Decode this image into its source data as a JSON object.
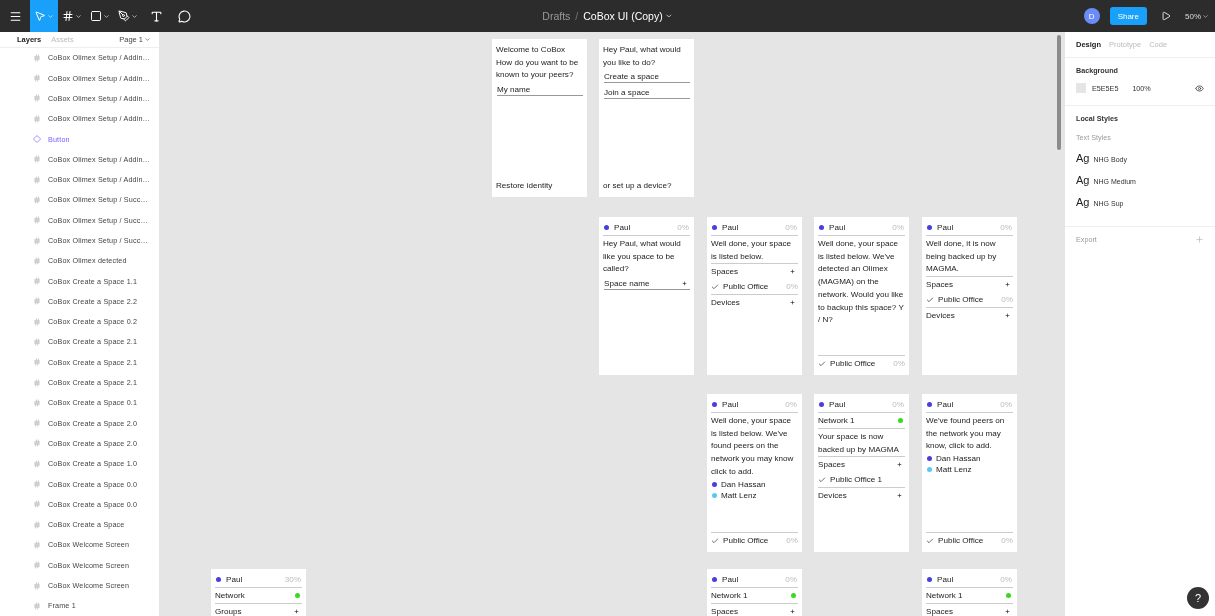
{
  "toolbar": {
    "tools": [
      {
        "kind": "move",
        "selected": true
      },
      {
        "kind": "frame",
        "selected": false
      },
      {
        "kind": "shape",
        "selected": false
      },
      {
        "kind": "pen",
        "selected": false
      },
      {
        "kind": "text",
        "selected": false
      },
      {
        "kind": "comment",
        "selected": false
      }
    ],
    "breadcrumb": "Drafts",
    "separator": "/",
    "file_name": "CoBox UI (Copy)",
    "avatar": "D",
    "share": "Share",
    "zoom": "50%"
  },
  "layers_panel": {
    "tabs": [
      {
        "label": "Layers",
        "selected": true
      },
      {
        "label": "Assets",
        "selected": false
      }
    ],
    "page": "Page 1",
    "layers": [
      {
        "kind": "frame",
        "name": "CoBox Olimex Setup / Addin…"
      },
      {
        "kind": "frame",
        "name": "CoBox Olimex Setup / Addin…"
      },
      {
        "kind": "frame",
        "name": "CoBox Olimex Setup / Addin…"
      },
      {
        "kind": "frame",
        "name": "CoBox Olimex Setup / Addin…"
      },
      {
        "kind": "component",
        "name": "Button"
      },
      {
        "kind": "frame",
        "name": "CoBox Olimex Setup / Addin…"
      },
      {
        "kind": "frame",
        "name": "CoBox Olimex Setup / Addin…"
      },
      {
        "kind": "frame",
        "name": "CoBox Olimex Setup / Succ…"
      },
      {
        "kind": "frame",
        "name": "CoBox Olimex Setup / Succ…"
      },
      {
        "kind": "frame",
        "name": "CoBox Olimex Setup / Succ…"
      },
      {
        "kind": "frame",
        "name": "CoBox Olimex detected"
      },
      {
        "kind": "frame",
        "name": "CoBox Create a Space 1.1"
      },
      {
        "kind": "frame",
        "name": "CoBox Create a Space 2.2"
      },
      {
        "kind": "frame",
        "name": "CoBox Create a Space 0.2"
      },
      {
        "kind": "frame",
        "name": "CoBox Create a Space 2.1"
      },
      {
        "kind": "frame",
        "name": "CoBox Create a Space 2.1"
      },
      {
        "kind": "frame",
        "name": "CoBox Create a Space 2.1"
      },
      {
        "kind": "frame",
        "name": "CoBox Create a Space 0.1"
      },
      {
        "kind": "frame",
        "name": "CoBox Create a Space 2.0"
      },
      {
        "kind": "frame",
        "name": "CoBox Create a Space 2.0"
      },
      {
        "kind": "frame",
        "name": "CoBox Create a Space 1.0"
      },
      {
        "kind": "frame",
        "name": "CoBox Create a Space 0.0"
      },
      {
        "kind": "frame",
        "name": "CoBox Create a Space 0.0"
      },
      {
        "kind": "frame",
        "name": "CoBox Create a Space"
      },
      {
        "kind": "frame",
        "name": "CoBox Welcome Screen"
      },
      {
        "kind": "frame",
        "name": "CoBox Welcome Screen"
      },
      {
        "kind": "frame",
        "name": "CoBox Welcome Screen"
      },
      {
        "kind": "frame",
        "name": "Frame 1"
      }
    ]
  },
  "canvas": {
    "frames": [
      {
        "blocks": [
          {
            "kind": "text",
            "text": "Welcome to CoBox"
          },
          {
            "kind": "text",
            "text": "How do you want to be known to your peers?"
          },
          {
            "kind": "field",
            "text": "My name"
          },
          {
            "kind": "bottom_text",
            "text": "Restore identity"
          }
        ]
      },
      {
        "blocks": [
          {
            "kind": "text",
            "text": "Hey Paul, what would you like to do?"
          },
          {
            "kind": "field",
            "text": "Create a space"
          },
          {
            "kind": "field",
            "text": "Join a space"
          },
          {
            "kind": "bottom_text",
            "text": "or set up a device?"
          }
        ]
      },
      {
        "blocks": [
          {
            "kind": "header",
            "name": "Paul",
            "color": "#4b3ee0",
            "percent": "0%"
          },
          {
            "kind": "text",
            "text": "Hey Paul, what would like you space to be called?"
          },
          {
            "kind": "field",
            "text": "Space name",
            "plus": true
          }
        ]
      },
      {
        "blocks": [
          {
            "kind": "header",
            "name": "Paul",
            "color": "#4b3ee0",
            "percent": "0%"
          },
          {
            "kind": "text",
            "text": "Well done, your space is listed below."
          },
          {
            "kind": "section",
            "text": "Spaces"
          },
          {
            "kind": "item",
            "text": "Public Office",
            "percent": "0%"
          },
          {
            "kind": "section",
            "text": "Devices"
          }
        ]
      },
      {
        "blocks": [
          {
            "kind": "header",
            "name": "Paul",
            "color": "#4b3ee0",
            "percent": "0%"
          },
          {
            "kind": "text",
            "text": "Well done, your space is listed below. We've detected an Olimex (MAGMA) on the network. Would you like to backup this space? Y / N?"
          },
          {
            "kind": "footer_item",
            "text": "Public Office",
            "percent": "0%"
          }
        ]
      },
      {
        "blocks": [
          {
            "kind": "header",
            "name": "Paul",
            "color": "#4b3ee0",
            "percent": "0%"
          },
          {
            "kind": "text",
            "text": "Well done, it is now being backed up by MAGMA."
          },
          {
            "kind": "section",
            "text": "Spaces"
          },
          {
            "kind": "item",
            "text": "Public Office",
            "percent": "0%"
          },
          {
            "kind": "section",
            "text": "Devices"
          }
        ]
      },
      {
        "blocks": [
          {
            "kind": "header",
            "name": "Paul",
            "color": "#4b3ee0",
            "percent": "0%"
          },
          {
            "kind": "text",
            "text": "Well done, your space is listed below. We've found peers on the network you may know click to add."
          },
          {
            "kind": "person",
            "text": "Dan Hassan",
            "color": "#4b3ee0"
          },
          {
            "kind": "person",
            "text": "Matt Lenz",
            "color": "#5ac8f0"
          },
          {
            "kind": "footer_item",
            "text": "Public Office",
            "percent": "0%"
          }
        ]
      },
      {
        "blocks": [
          {
            "kind": "header",
            "name": "Paul",
            "color": "#4b3ee0",
            "percent": "0%"
          },
          {
            "kind": "network",
            "text": "Network 1",
            "color": "#3ad81e"
          },
          {
            "kind": "text",
            "text": "Your space is now backed up by MAGMA"
          },
          {
            "kind": "section",
            "text": "Spaces"
          },
          {
            "kind": "item",
            "text": "Public Office 1"
          },
          {
            "kind": "section",
            "text": "Devices"
          }
        ]
      },
      {
        "blocks": [
          {
            "kind": "header",
            "name": "Paul",
            "color": "#4b3ee0",
            "percent": "0%"
          },
          {
            "kind": "text",
            "text": "We've found peers on the network you may know, click to add."
          },
          {
            "kind": "person",
            "text": "Dan Hassan",
            "color": "#4b3ee0"
          },
          {
            "kind": "person",
            "text": "Matt Lenz",
            "color": "#5ac8f0"
          },
          {
            "kind": "footer_item",
            "text": "Public Office",
            "percent": "0%"
          }
        ]
      },
      {
        "blocks": [
          {
            "kind": "header",
            "name": "Paul",
            "color": "#4b3ee0",
            "percent": "30%"
          },
          {
            "kind": "network",
            "text": "Network",
            "color": "#3ad81e"
          },
          {
            "kind": "section",
            "text": "Groups"
          }
        ]
      },
      {
        "blocks": [
          {
            "kind": "header",
            "name": "Paul",
            "color": "#4b3ee0",
            "percent": "0%"
          },
          {
            "kind": "network",
            "text": "Network 1",
            "color": "#3ad81e"
          },
          {
            "kind": "section",
            "text": "Spaces"
          }
        ]
      },
      {
        "blocks": [
          {
            "kind": "header",
            "name": "Paul",
            "color": "#4b3ee0",
            "percent": "0%"
          },
          {
            "kind": "network",
            "text": "Network 1",
            "color": "#3ad81e"
          },
          {
            "kind": "section",
            "text": "Spaces"
          }
        ]
      }
    ],
    "help": "?"
  },
  "design_panel": {
    "tabs": [
      {
        "label": "Design",
        "selected": true
      },
      {
        "label": "Prototype",
        "selected": false
      },
      {
        "label": "Code",
        "selected": false
      }
    ],
    "background": {
      "title": "Background",
      "hex": "E5E5E5",
      "opacity": "100%"
    },
    "local_styles": {
      "title": "Local Styles",
      "subtitle": "Text Styles",
      "styles": [
        {
          "sample": "Ag",
          "name": "NHG Body"
        },
        {
          "sample": "Ag",
          "name": "NHG Medium"
        },
        {
          "sample": "Ag",
          "name": "NHG Sup"
        }
      ]
    },
    "export": "Export"
  }
}
